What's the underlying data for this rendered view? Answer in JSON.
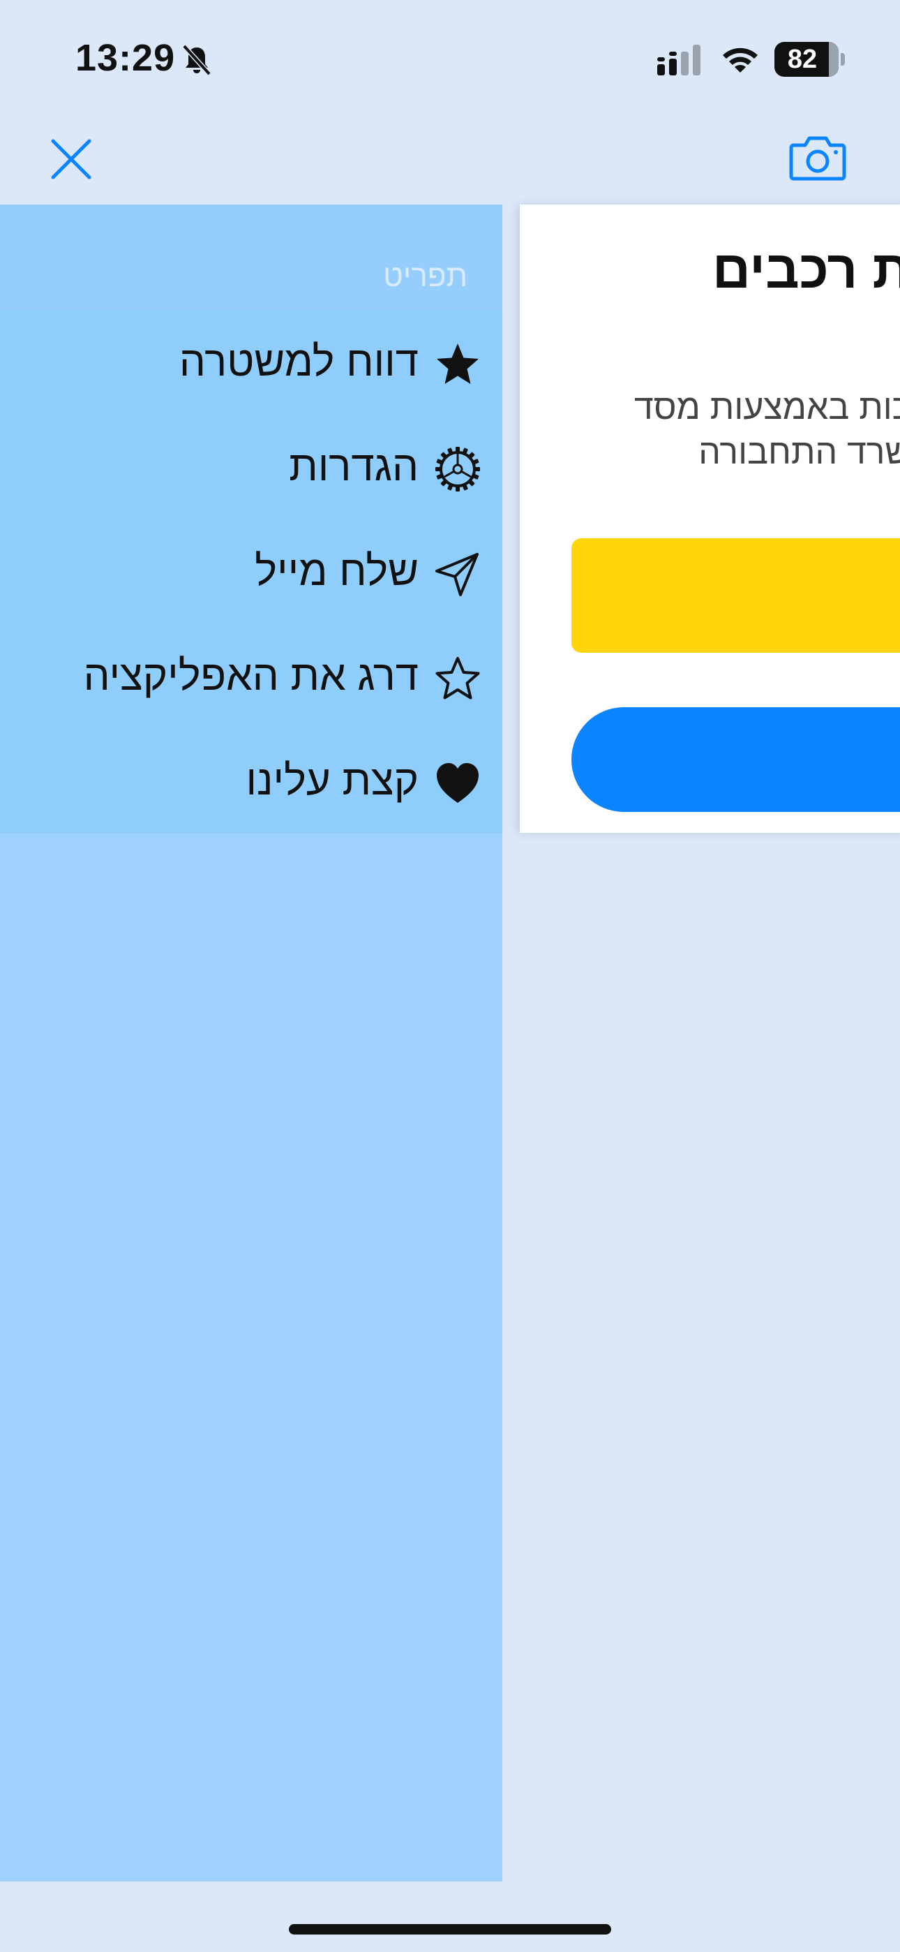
{
  "status_bar": {
    "time": "13:29",
    "battery_level": "82",
    "icons": [
      "bell-slash-icon",
      "cellular-signal-icon",
      "wifi-icon",
      "battery-icon"
    ]
  },
  "nav": {
    "close_icon": "close-icon",
    "camera_icon": "camera-icon",
    "accent_color": "#0a84ff"
  },
  "menu": {
    "header_title": "תפריט",
    "items": [
      {
        "label": "דווח למשטרה",
        "icon": "star-filled-icon"
      },
      {
        "label": "הגדרות",
        "icon": "gear-icon"
      },
      {
        "label": "שלח מייל",
        "icon": "paper-plane-icon"
      },
      {
        "label": "דרג את האפליקציה",
        "icon": "star-outline-icon"
      },
      {
        "label": "קצת עלינו",
        "icon": "heart-icon"
      }
    ],
    "background_color": "#9fd1ff"
  },
  "main": {
    "title": "ת רכבים",
    "description_line1": "כות באמצעות מסד",
    "description_line2": "שרד התחבורה",
    "yellow_button_color": "#ffd60a",
    "blue_button_color": "#0a84ff"
  }
}
